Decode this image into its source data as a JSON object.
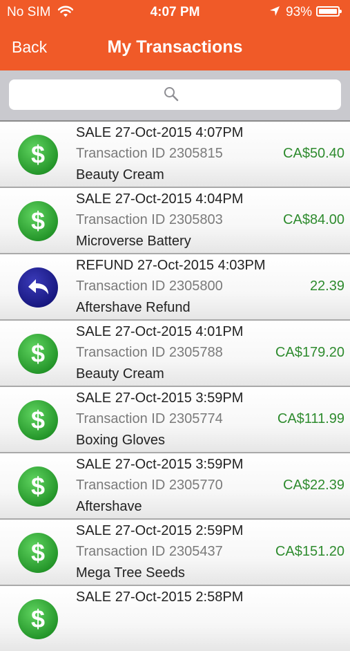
{
  "status_bar": {
    "carrier": "No SIM",
    "time": "4:07 PM",
    "battery": "93%",
    "battery_level": 0.93
  },
  "nav": {
    "back_label": "Back",
    "title": "My Transactions"
  },
  "search": {
    "placeholder": ""
  },
  "colors": {
    "header": "#f05a28",
    "sale_green": "#2fa33a",
    "refund_blue": "#1f1f8f",
    "amount_green": "#2e8b2e"
  },
  "transactions": [
    {
      "kind": "sale",
      "icon": "dollar-icon",
      "header": "SALE 27-Oct-2015 4:07PM",
      "txid": "Transaction ID 2305815",
      "item": "Beauty Cream",
      "amount": "CA$50.40"
    },
    {
      "kind": "sale",
      "icon": "dollar-icon",
      "header": "SALE 27-Oct-2015 4:04PM",
      "txid": "Transaction ID 2305803",
      "item": "Microverse Battery",
      "amount": "CA$84.00"
    },
    {
      "kind": "refund",
      "icon": "refund-arrow-icon",
      "header": "REFUND 27-Oct-2015 4:03PM",
      "txid": "Transaction ID 2305800",
      "item": "Aftershave Refund",
      "amount": "22.39"
    },
    {
      "kind": "sale",
      "icon": "dollar-icon",
      "header": "SALE 27-Oct-2015 4:01PM",
      "txid": "Transaction ID 2305788",
      "item": "Beauty Cream",
      "amount": "CA$179.20"
    },
    {
      "kind": "sale",
      "icon": "dollar-icon",
      "header": "SALE 27-Oct-2015 3:59PM",
      "txid": "Transaction ID 2305774",
      "item": "Boxing Gloves",
      "amount": "CA$111.99"
    },
    {
      "kind": "sale",
      "icon": "dollar-icon",
      "header": "SALE 27-Oct-2015 3:59PM",
      "txid": "Transaction ID 2305770",
      "item": "Aftershave",
      "amount": "CA$22.39"
    },
    {
      "kind": "sale",
      "icon": "dollar-icon",
      "header": "SALE 27-Oct-2015 2:59PM",
      "txid": "Transaction ID 2305437",
      "item": "Mega Tree Seeds",
      "amount": "CA$151.20"
    },
    {
      "kind": "sale",
      "icon": "dollar-icon",
      "header": "SALE 27-Oct-2015 2:58PM",
      "txid": "",
      "item": "",
      "amount": ""
    }
  ]
}
